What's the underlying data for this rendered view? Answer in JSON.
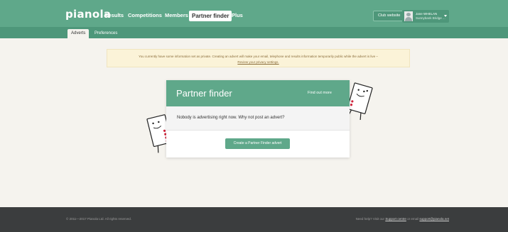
{
  "header": {
    "logo": "pianola",
    "nav": [
      {
        "label": "Results"
      },
      {
        "label": "Competitions"
      },
      {
        "label": "Members"
      },
      {
        "label": "Partner finder"
      },
      {
        "label": "Plus"
      }
    ],
    "club_button": "Club website",
    "user": {
      "name": "Jane WHELAN",
      "club": "Sunnybank Bridge ..."
    }
  },
  "subnav": {
    "tabs": [
      {
        "label": "Adverts"
      },
      {
        "label": "Preferences"
      }
    ]
  },
  "notice": {
    "text": "You currently have some information set as private. Creating an advert will make your email, telephone and results information temporarily public while the advert is live –",
    "link": "Review your privacy settings."
  },
  "card": {
    "title": "Partner finder",
    "find_more": "Find out more",
    "message": "Nobody is advertising right now. Why not post an advert?",
    "button": "Create a Partner Finder advert"
  },
  "footer": {
    "copyright": "© 2011—2017 Pianola Ltd. All rights reserved.",
    "help_prefix": "Need help? Visit our",
    "help_link": "Support centre",
    "email_prefix": "or email",
    "email_link": "support@pianola.net"
  },
  "colors": {
    "brand_green": "#5fa88a",
    "brand_green_dark": "#4e977a",
    "page_bg": "#f5f3ee",
    "footer_bg": "#3b3d3e",
    "notice_bg": "#fbf3d8"
  }
}
